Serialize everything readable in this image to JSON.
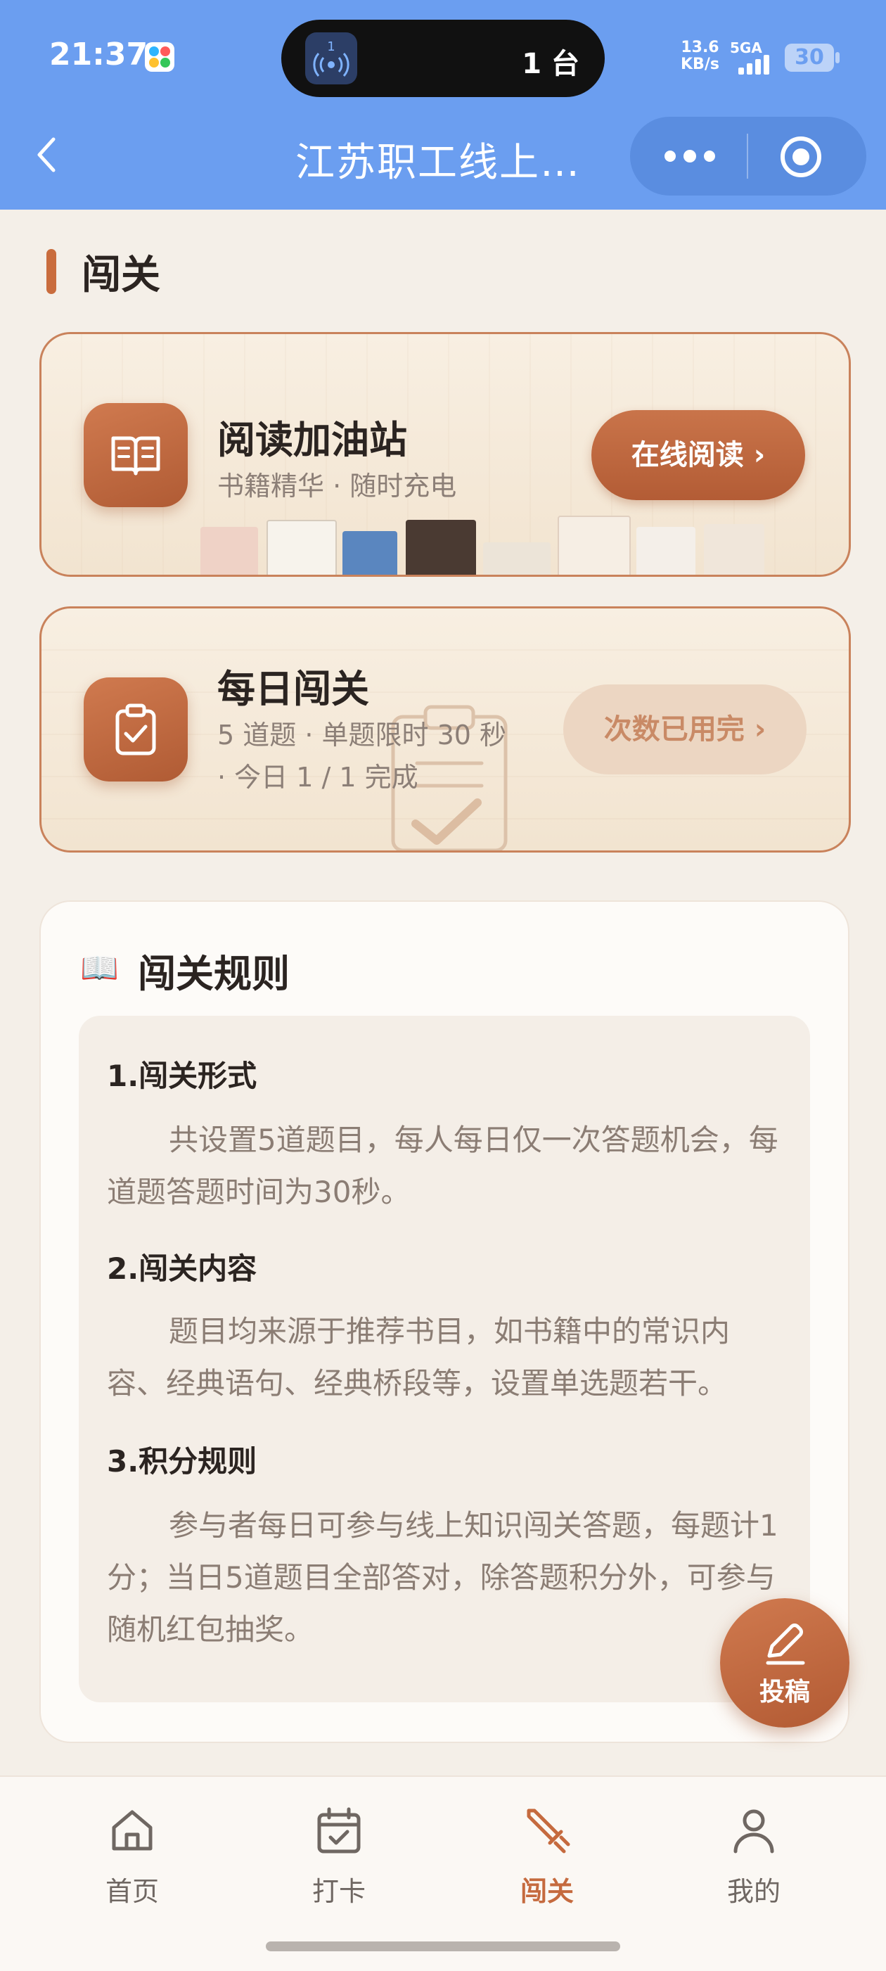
{
  "status_bar": {
    "time": "21:37",
    "island_count": "1 台",
    "island_badge": "1",
    "net_speed_value": "13.6",
    "net_speed_unit": "KB/s",
    "network": "5GA",
    "battery": "30"
  },
  "header": {
    "title": "江苏职工线上…"
  },
  "section": {
    "title": "闯关"
  },
  "reading_card": {
    "title": "阅读加油站",
    "subtitle": "书籍精华 · 随时充电",
    "button": "在线阅读 ›",
    "icon": "book-open-icon"
  },
  "daily_card": {
    "title": "每日闯关",
    "subtitle_line1": "5 道题 · 单题限时 30 秒",
    "subtitle_line2": "· 今日 1 / 1 完成",
    "button": "次数已用完 ›",
    "icon": "clipboard-check-icon"
  },
  "rules": {
    "icon": "📖",
    "title": "闯关规则",
    "items": [
      {
        "heading": "1.闯关形式",
        "text": "共设置5道题目，每人每日仅一次答题机会，每道题答题时间为30秒。"
      },
      {
        "heading": "2.闯关内容",
        "text": "题目均来源于推荐书目，如书籍中的常识内容、经典语句、经典桥段等，设置单选题若干。"
      },
      {
        "heading": "3.积分规则",
        "text": "参与者每日可参与线上知识闯关答题，每题计1分；当日5道题目全部答对，除答题积分外，可参与随机红包抽奖。"
      }
    ]
  },
  "fab": {
    "label": "投稿",
    "icon": "pencil-icon"
  },
  "tabbar": {
    "items": [
      {
        "label": "首页",
        "icon": "home-icon"
      },
      {
        "label": "打卡",
        "icon": "calendar-check-icon"
      },
      {
        "label": "闯关",
        "icon": "sword-icon",
        "active": true
      },
      {
        "label": "我的",
        "icon": "user-icon"
      }
    ]
  },
  "colors": {
    "header_blue": "#6b9ef0",
    "accent": "#c56a3e",
    "background": "#f4efe8"
  }
}
